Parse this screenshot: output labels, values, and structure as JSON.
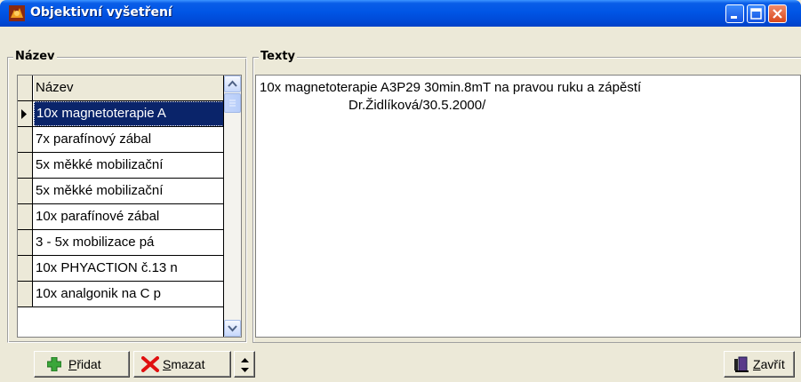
{
  "window": {
    "title": "Objektivní vyšetření",
    "title_bar_color": "#0055e5"
  },
  "left_group": {
    "label": "Název",
    "grid": {
      "header": "Název",
      "rows": [
        "10x magnetoterapie A",
        "7x parafínový zábal",
        "5x měkké mobilizační",
        "5x měkké mobilizační",
        "10x parafínové zábal",
        "3 - 5x mobilizace pá",
        "10x PHYACTION č.13 n",
        "10x analgonik na C p"
      ],
      "selected_index": 0,
      "selection_color": "#0a246a"
    }
  },
  "right_group": {
    "label": "Texty",
    "memo_lines": [
      "10x magnetoterapie A3P29 30min.8mT na pravou ruku a zápěstí",
      "                        Dr.Židlíková/30.5.2000/"
    ]
  },
  "buttons": {
    "add": {
      "label": "Přidat",
      "icon": "plus-icon",
      "accent": "#3aa63a"
    },
    "delete": {
      "label": "Smazat",
      "icon": "red-x-icon",
      "accent": "#e01010"
    },
    "spin": {
      "icon": "spin-up-down-icon"
    },
    "close": {
      "label": "Zavřít",
      "icon": "door-exit-icon"
    }
  }
}
